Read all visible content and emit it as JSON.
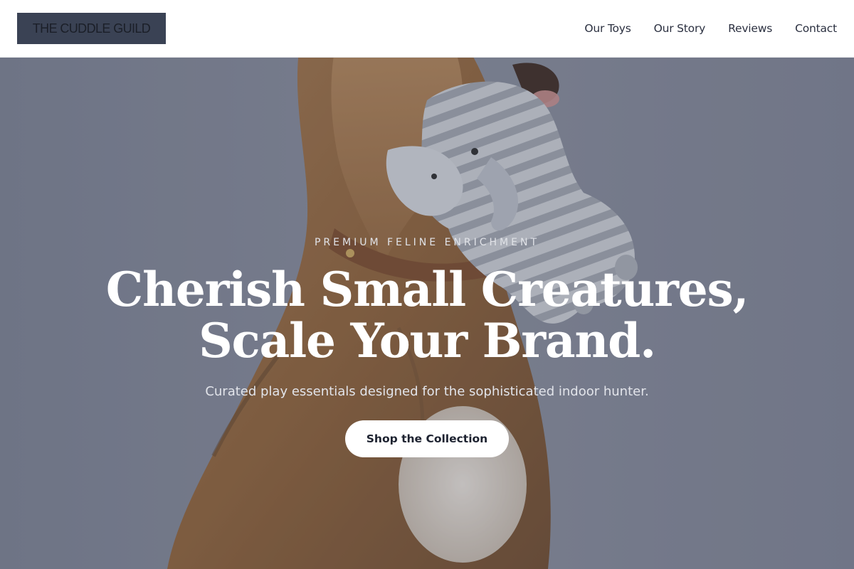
{
  "header": {
    "logo_text": "THE CUDDLE GUILD",
    "nav": [
      {
        "label": "Our Toys"
      },
      {
        "label": "Our Story"
      },
      {
        "label": "Reviews"
      },
      {
        "label": "Contact"
      }
    ]
  },
  "hero": {
    "eyebrow": "PREMIUM FELINE ENRICHMENT",
    "headline_line1": "Cherish Small Creatures,",
    "headline_line2": "Scale Your Brand.",
    "subhead": "Curated play essentials designed for the sophisticated indoor hunter.",
    "cta_label": "Shop the Collection",
    "background_image": "golden dog holding knitted striped elephant plush toy"
  },
  "colors": {
    "logo_bg": "#3a4254",
    "nav_text": "#2b3040",
    "hero_overlay": "#6f7586",
    "cta_bg": "#ffffff",
    "cta_text": "#1d2230"
  }
}
